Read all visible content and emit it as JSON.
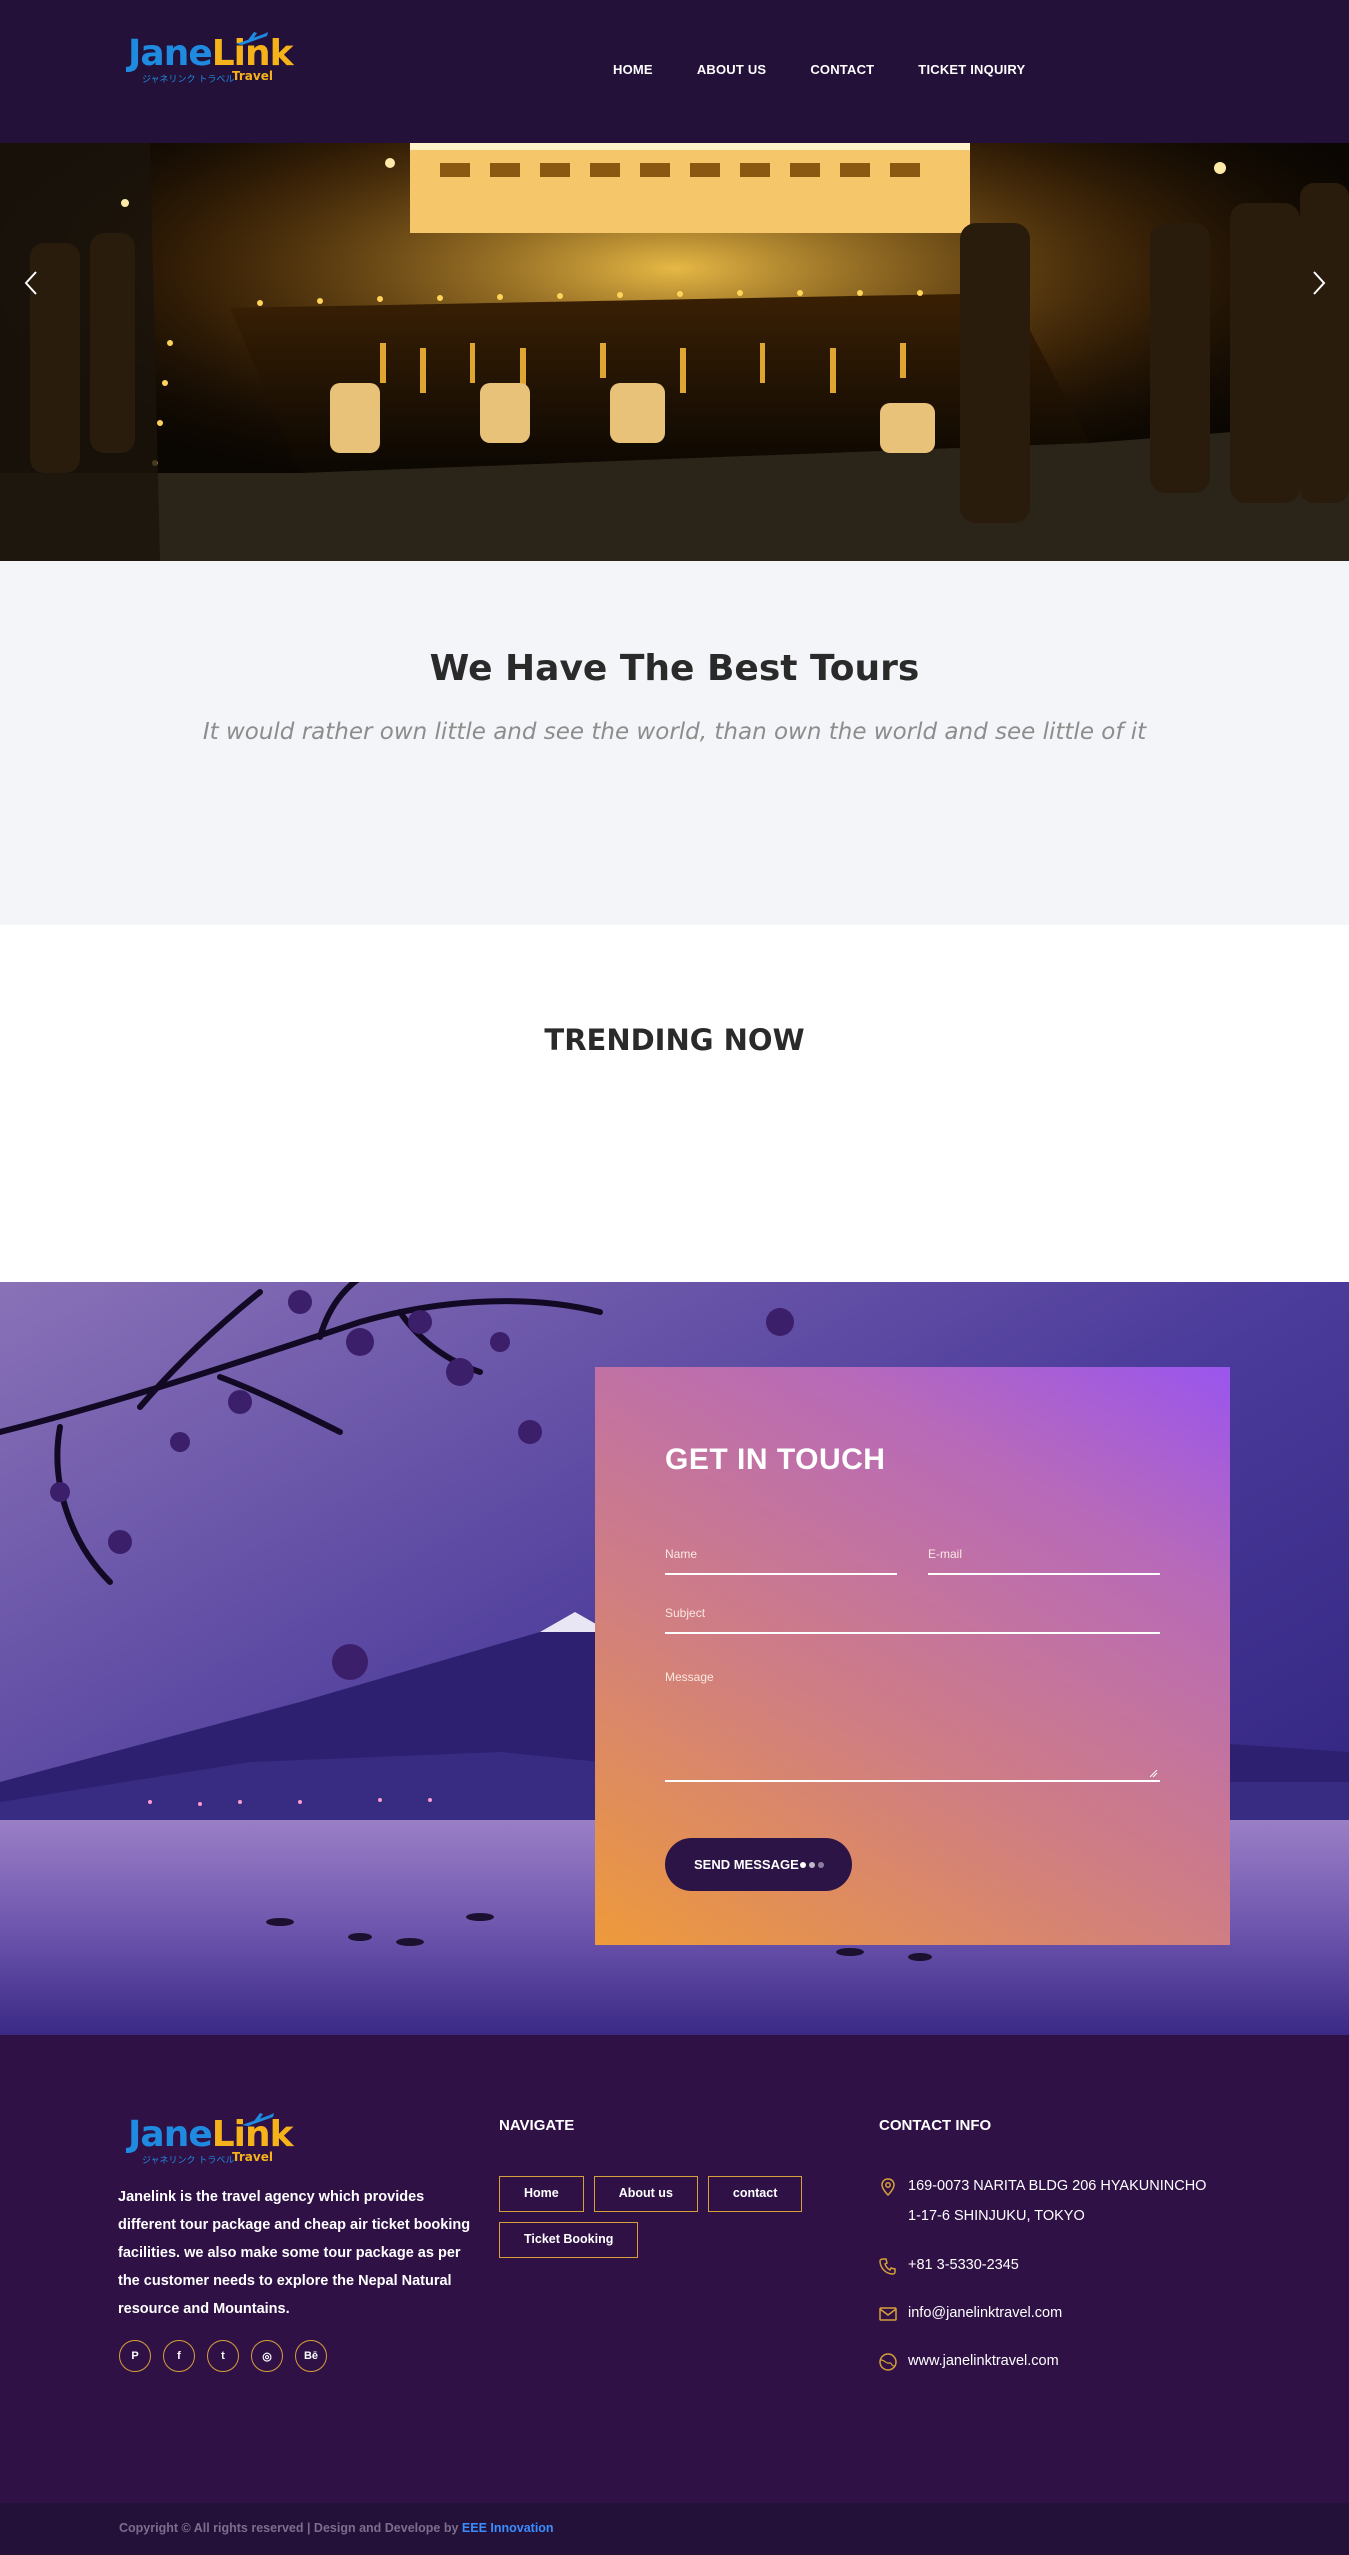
{
  "brand": {
    "logo_main_a": "Jane",
    "logo_main_b": "Link",
    "logo_sub": "ジャネリンク トラベル",
    "logo_travel": "Travel"
  },
  "nav": {
    "items": [
      "HOME",
      "ABOUT US",
      "CONTACT",
      "TICKET INQUIRY"
    ]
  },
  "hero": {
    "prev_icon": "chevron-left-icon",
    "next_icon": "chevron-right-icon"
  },
  "intro": {
    "title": "We Have The Best Tours",
    "quote": "It would rather own little and see the world, than own the world and see little of it"
  },
  "trending": {
    "title": "TRENDING NOW"
  },
  "contact": {
    "title": "GET IN TOUCH",
    "name_placeholder": "Name",
    "email_placeholder": "E-mail",
    "subject_placeholder": "Subject",
    "message_placeholder": "Message",
    "send_label": "SEND MESSAGE"
  },
  "footer": {
    "about": "Janelink is the travel agency which provides different tour package and cheap air ticket booking facilities. we also make some tour package as per the customer needs to explore the Nepal Natural resource and Mountains.",
    "socials": [
      {
        "icon": "pinterest-icon",
        "glyph": "P"
      },
      {
        "icon": "facebook-icon",
        "glyph": "f"
      },
      {
        "icon": "twitter-icon",
        "glyph": "t"
      },
      {
        "icon": "dribbble-icon",
        "glyph": "◎"
      },
      {
        "icon": "behance-icon",
        "glyph": "Bē"
      }
    ],
    "navigate_title": "NAVIGATE",
    "navigate_links": [
      "Home",
      "About us",
      "contact",
      "Ticket Booking"
    ],
    "contact_title": "CONTACT INFO",
    "address_line1": "169-0073 NARITA BLDG 206 HYAKUNINCHO",
    "address_line2": "1-17-6 SHINJUKU, TOKYO",
    "phone": "+81 3-5330-2345",
    "email": "info@janelinktravel.com",
    "website": "www.janelinktravel.com"
  },
  "copyright": {
    "text": "Copyright © All rights reserved | Design and Develope  by ",
    "link_text": "EEE Innovation"
  },
  "colors": {
    "header_bg": "#231139",
    "footer_bg": "#2f1146",
    "accent_gold": "#d6a039",
    "logo_blue": "#1f8be0",
    "logo_orange": "#f6b21a",
    "button_dark": "#2d1446",
    "link_blue": "#3a8dff"
  }
}
